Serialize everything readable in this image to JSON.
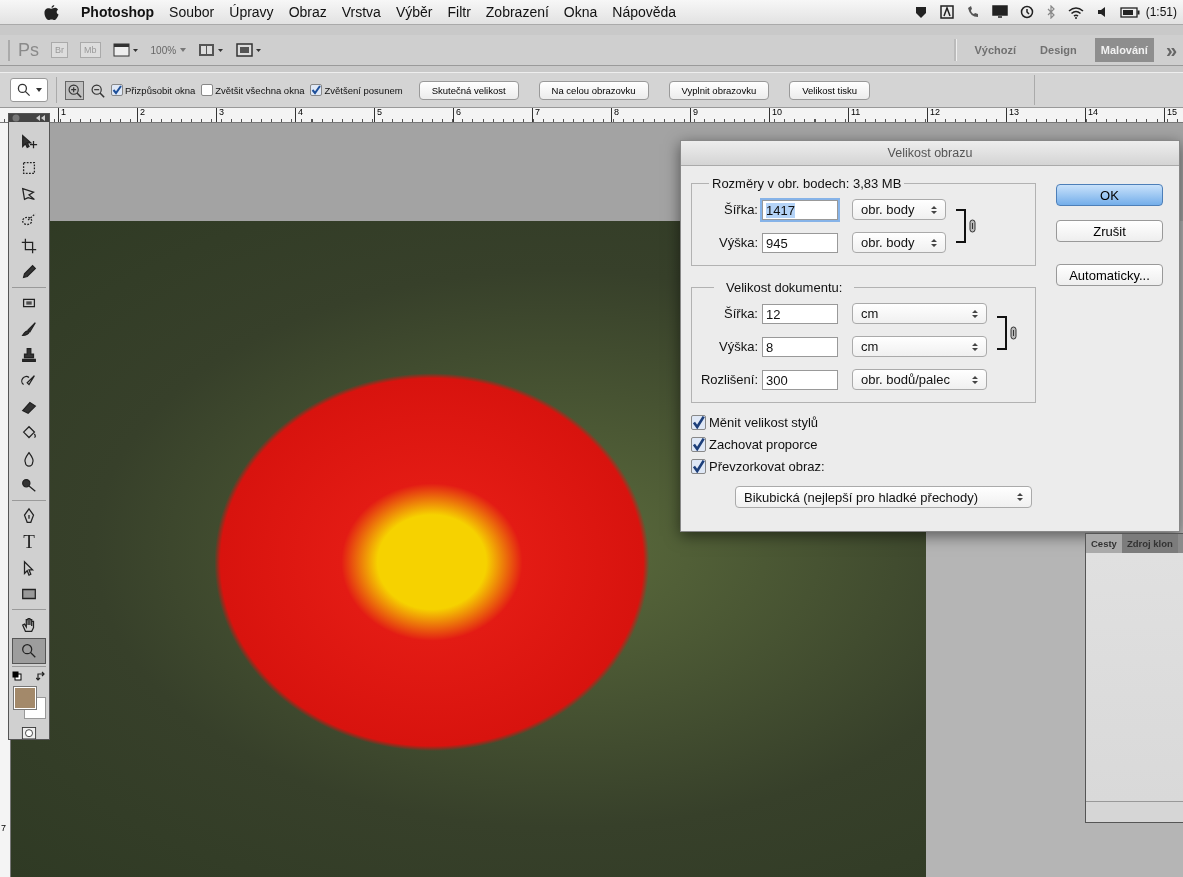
{
  "menu_bar": {
    "app": "Photoshop",
    "items": [
      "Soubor",
      "Úpravy",
      "Obraz",
      "Vrstva",
      "Výběr",
      "Filtr",
      "Zobrazení",
      "Okna",
      "Nápověda"
    ],
    "battery_time": "(1:51)"
  },
  "app_bar": {
    "logo": "Ps",
    "bridge": "Br",
    "mini_bridge": "Mb",
    "zoom": "100%",
    "workspaces": [
      {
        "label": "Výchozí",
        "selected": false
      },
      {
        "label": "Design",
        "selected": false
      },
      {
        "label": "Malování",
        "selected": true
      }
    ],
    "more": "»"
  },
  "options_bar": {
    "zoom_modes": [
      {
        "kind": "zoom-in",
        "selected": true
      },
      {
        "kind": "zoom-out",
        "selected": false
      }
    ],
    "checkboxes": [
      {
        "label": "Přizpůsobit okna",
        "checked": true
      },
      {
        "label": "Zvětšit všechna okna",
        "checked": false
      },
      {
        "label": "Zvětšení posunem",
        "checked": true
      }
    ],
    "buttons": [
      "Skutečná velikost",
      "Na celou obrazovku",
      "Vyplnit obrazovku",
      "Velikost tisku"
    ]
  },
  "ruler": {
    "marks": [
      "1",
      "2",
      "3",
      "4",
      "5",
      "6",
      "7",
      "8",
      "9",
      "10",
      "11",
      "12",
      "13",
      "14",
      "15"
    ]
  },
  "vertical_ruler": {
    "marks": [
      "7"
    ]
  },
  "tool_groups": [
    {
      "tools": [
        {
          "kind": "move",
          "selected": false
        },
        {
          "kind": "marquee",
          "selected": false
        },
        {
          "kind": "lasso",
          "selected": false
        },
        {
          "kind": "quick-selection",
          "selected": false
        },
        {
          "kind": "crop",
          "selected": false
        },
        {
          "kind": "eyedropper",
          "selected": false
        }
      ]
    },
    {
      "tools": [
        {
          "kind": "healing",
          "selected": false
        },
        {
          "kind": "brush",
          "selected": false
        },
        {
          "kind": "stamp",
          "selected": false
        },
        {
          "kind": "history-brush",
          "selected": false
        },
        {
          "kind": "eraser",
          "selected": false
        },
        {
          "kind": "bucket",
          "selected": false
        },
        {
          "kind": "blur",
          "selected": false
        },
        {
          "kind": "dodge",
          "selected": false
        }
      ]
    },
    {
      "tools": [
        {
          "kind": "pen",
          "selected": false
        },
        {
          "kind": "type",
          "glyph": "T",
          "selected": false
        },
        {
          "kind": "path-selection",
          "selected": false
        },
        {
          "kind": "rectangle",
          "selected": false
        }
      ]
    },
    {
      "tools": [
        {
          "kind": "hand",
          "selected": false
        },
        {
          "kind": "zoom",
          "selected": true
        }
      ]
    }
  ],
  "dialog": {
    "title": "Velikost obrazu",
    "pixel_dimensions": {
      "legend": "Rozměry v obr. bodech:",
      "size": "3,83 MB",
      "rows": [
        {
          "label": "Šířka:",
          "value": "1417",
          "selected": true,
          "unit": "obr. body"
        },
        {
          "label": "Výška:",
          "value": "945",
          "selected": false,
          "unit": "obr. body"
        }
      ]
    },
    "document_size": {
      "legend": "Velikost dokumentu:",
      "rows": [
        {
          "label": "Šířka:",
          "value": "12",
          "selected": false,
          "unit": "cm"
        },
        {
          "label": "Výška:",
          "value": "8",
          "selected": false,
          "unit": "cm"
        },
        {
          "label": "Rozlišení:",
          "value": "300",
          "selected": false,
          "unit": "obr. bodů/palec"
        }
      ]
    },
    "checkboxes": [
      {
        "label": "Měnit velikost stylů",
        "checked": true
      },
      {
        "label": "Zachovat proporce",
        "checked": true
      },
      {
        "label": "Převzorkovat obraz:",
        "checked": true
      }
    ],
    "resample_method": "Bikubická (nejlepší pro hladké přechody)",
    "buttons": [
      {
        "label": "OK",
        "default": true
      },
      {
        "label": "Zrušit",
        "default": false
      },
      {
        "label": "Automaticky...",
        "default": false
      }
    ]
  },
  "paths_panel": {
    "tabs": [
      {
        "label": "Cesty",
        "selected": true
      },
      {
        "label": "Zdroj klon",
        "selected": false
      }
    ]
  }
}
